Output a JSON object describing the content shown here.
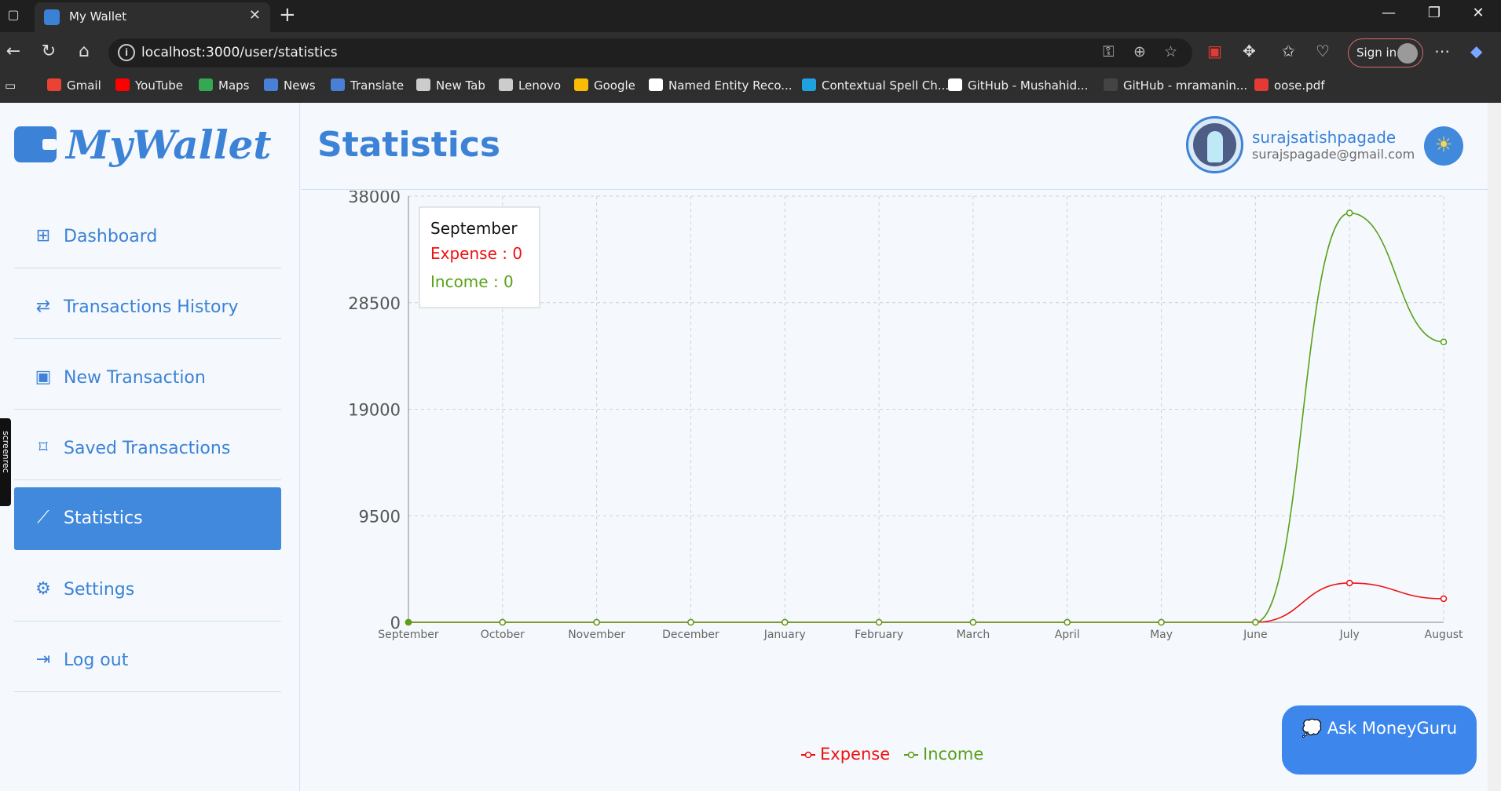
{
  "browser": {
    "tab_title": "My Wallet",
    "url": "localhost:3000/user/statistics",
    "sign_in": "Sign in",
    "bookmarks": [
      {
        "label": "Gmail",
        "color": "#ea4335"
      },
      {
        "label": "YouTube",
        "color": "#ff0000"
      },
      {
        "label": "Maps",
        "color": "#34a853"
      },
      {
        "label": "News",
        "color": "#4a7fd6"
      },
      {
        "label": "Translate",
        "color": "#4a7fd6"
      },
      {
        "label": "New Tab",
        "color": "#cccccc"
      },
      {
        "label": "Lenovo",
        "color": "#cccccc"
      },
      {
        "label": "Google",
        "color": "#fbbc05"
      },
      {
        "label": "Named Entity Reco...",
        "color": "#ffffff"
      },
      {
        "label": "Contextual Spell Ch...",
        "color": "#1fa3e0"
      },
      {
        "label": "GitHub - Mushahid...",
        "color": "#ffffff"
      },
      {
        "label": "GitHub - mramanin...",
        "color": "#444444"
      },
      {
        "label": "oose.pdf",
        "color": "#e53935"
      }
    ]
  },
  "app": {
    "brand": "MyWallet",
    "page_title": "Statistics",
    "user_name": "surajsatishpagade",
    "user_email": "surajspagade@gmail.com",
    "ask_button": "💭 Ask MoneyGuru",
    "screenrec_label": "screenrec",
    "menu": [
      {
        "label": "Dashboard",
        "icon": "grid-icon",
        "glyph": "⊞",
        "active": false
      },
      {
        "label": "Transactions History",
        "icon": "exchange-icon",
        "glyph": "⇄",
        "active": false
      },
      {
        "label": "New Transaction",
        "icon": "calendar-plus-icon",
        "glyph": "▣",
        "active": false
      },
      {
        "label": "Saved Transactions",
        "icon": "bookmark-icon",
        "glyph": "⌑",
        "active": false
      },
      {
        "label": "Statistics",
        "icon": "line-chart-icon",
        "glyph": "⟋",
        "active": true
      },
      {
        "label": "Settings",
        "icon": "gear-icon",
        "glyph": "⚙",
        "active": false
      },
      {
        "label": "Log out",
        "icon": "logout-icon",
        "glyph": "⇥",
        "active": false
      }
    ]
  },
  "chart_data": {
    "type": "line",
    "categories": [
      "September",
      "October",
      "November",
      "December",
      "January",
      "February",
      "March",
      "April",
      "May",
      "June",
      "July",
      "August"
    ],
    "y_ticks": [
      "0",
      "9500",
      "19000",
      "28500",
      "38000"
    ],
    "ylim": [
      0,
      38000
    ],
    "grid": true,
    "legend_position": "bottom",
    "series": [
      {
        "name": "Expense",
        "color": "#ee1111",
        "values": [
          0,
          0,
          0,
          0,
          0,
          0,
          0,
          0,
          0,
          0,
          3500,
          2100
        ]
      },
      {
        "name": "Income",
        "color": "#5aa018",
        "values": [
          0,
          0,
          0,
          0,
          0,
          0,
          0,
          0,
          0,
          0,
          36500,
          25000
        ]
      }
    ],
    "tooltip": {
      "title": "September",
      "lines": [
        "Expense : 0",
        "Income : 0"
      ]
    }
  }
}
